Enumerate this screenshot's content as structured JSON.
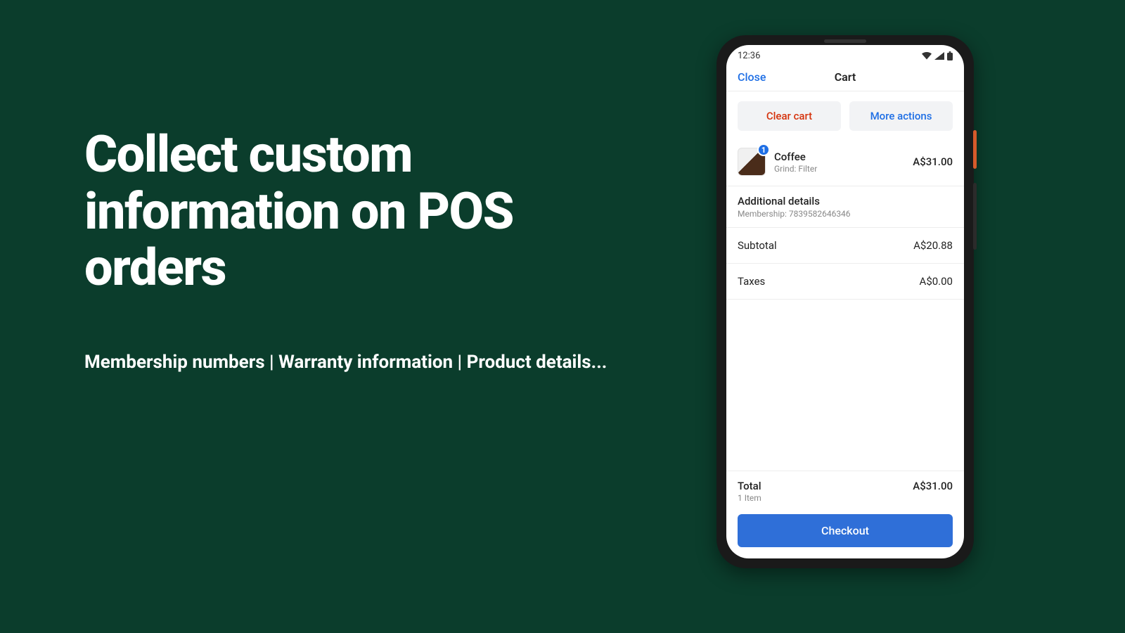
{
  "marketing": {
    "headline": "Collect custom information on POS orders",
    "subline": "Membership numbers | Warranty information | Product details..."
  },
  "statusbar": {
    "time": "12:36"
  },
  "nav": {
    "close": "Close",
    "title": "Cart"
  },
  "actions": {
    "clear": "Clear cart",
    "more": "More actions"
  },
  "item": {
    "qty": "1",
    "name": "Coffee",
    "variant": "Grind: Filter",
    "price": "A$31.00"
  },
  "additional": {
    "title": "Additional details",
    "line": "Membership: 7839582646346"
  },
  "subtotal": {
    "label": "Subtotal",
    "value": "A$20.88"
  },
  "taxes": {
    "label": "Taxes",
    "value": "A$0.00"
  },
  "total": {
    "label": "Total",
    "items": "1 Item",
    "value": "A$31.00"
  },
  "checkout": "Checkout"
}
